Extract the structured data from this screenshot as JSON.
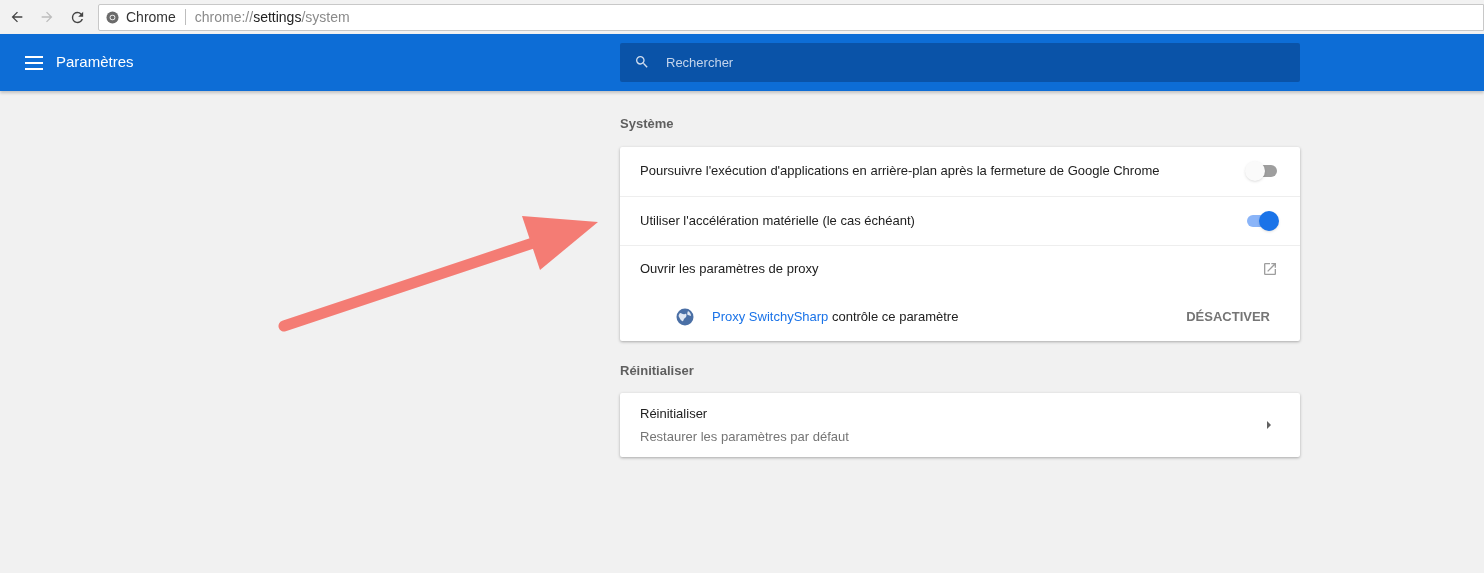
{
  "browser": {
    "site_label": "Chrome",
    "url": "chrome://**settings**/system",
    "forward_disabled": true
  },
  "header": {
    "title": "Paramètres",
    "search": {
      "placeholder": "Rechercher"
    }
  },
  "sections": [
    {
      "title": "Système",
      "rows": [
        {
          "kind": "toggle",
          "label": "Poursuivre l'exécution d'applications en arrière-plan après la fermeture de Google Chrome",
          "on": false
        },
        {
          "kind": "toggle",
          "label": "Utiliser l'accélération matérielle (le cas échéant)",
          "on": true
        },
        {
          "kind": "external",
          "label": "Ouvrir les paramètres de proxy"
        },
        {
          "kind": "extension",
          "link": "Proxy SwitchySharp",
          "text": "contrôle ce paramètre",
          "action": "DÉSACTIVER"
        }
      ]
    },
    {
      "title": "Réinitialiser",
      "rows": [
        {
          "kind": "submenu",
          "label": "Réinitialiser",
          "sublabel": "Restaurer les paramètres par défaut"
        }
      ]
    }
  ]
}
